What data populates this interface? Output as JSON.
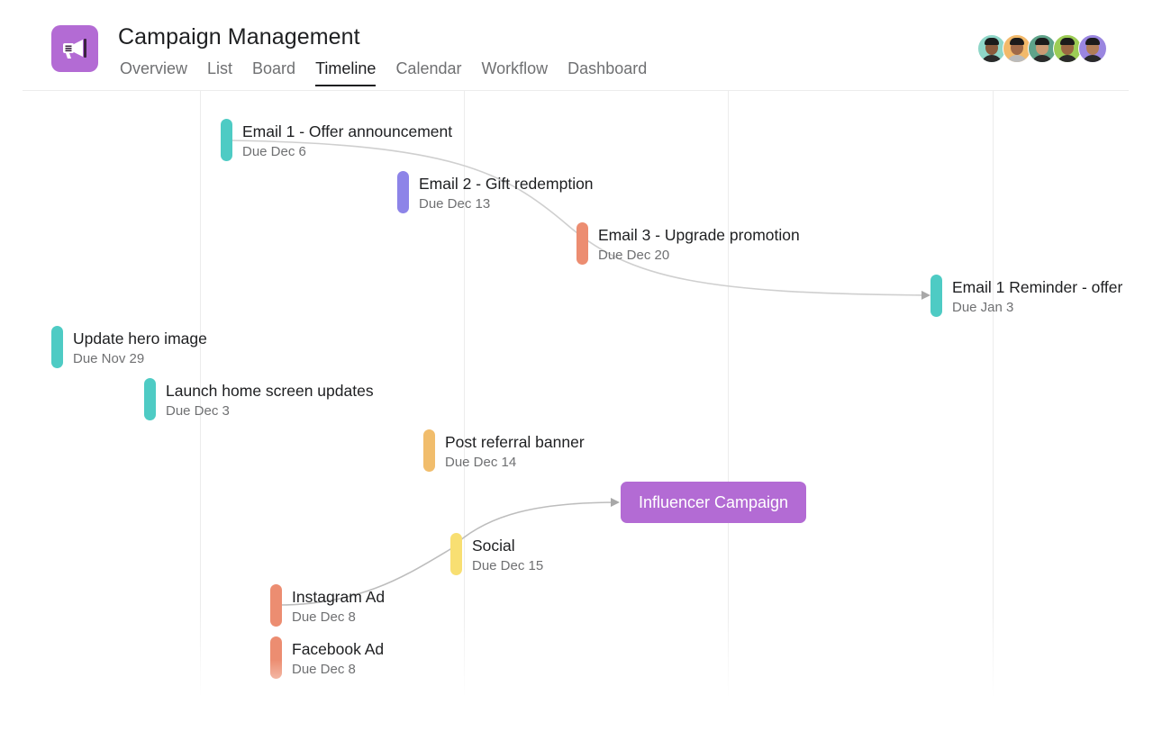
{
  "header": {
    "title": "Campaign Management",
    "app_icon": "megaphone-icon",
    "app_icon_color": "#b36bd4",
    "tabs": [
      {
        "label": "Overview",
        "active": false
      },
      {
        "label": "List",
        "active": false
      },
      {
        "label": "Board",
        "active": false
      },
      {
        "label": "Timeline",
        "active": true
      },
      {
        "label": "Calendar",
        "active": false
      },
      {
        "label": "Workflow",
        "active": false
      },
      {
        "label": "Dashboard",
        "active": false
      }
    ],
    "avatars": [
      {
        "color": "#8fd6c8"
      },
      {
        "color": "#f2b96a"
      },
      {
        "color": "#5fa38a"
      },
      {
        "color": "#9ccc55"
      },
      {
        "color": "#9a86e0"
      }
    ]
  },
  "timeline": {
    "tasks": [
      {
        "name": "Email 1 - Offer announcement",
        "due": "Due Dec 6",
        "color": "#4ecbc4"
      },
      {
        "name": "Email 2 - Gift redemption",
        "due": "Due Dec 13",
        "color": "#8d84e8"
      },
      {
        "name": "Email 3 - Upgrade promotion",
        "due": "Due Dec 20",
        "color": "#ec8d71"
      },
      {
        "name": "Email 1 Reminder - offer",
        "due": "Due Jan 3",
        "color": "#4ecbc4"
      },
      {
        "name": "Update hero image",
        "due": "Due Nov 29",
        "color": "#4ecbc4"
      },
      {
        "name": "Launch home screen updates",
        "due": "Due Dec 3",
        "color": "#4ecbc4"
      },
      {
        "name": "Post referral banner",
        "due": "Due Dec 14",
        "color": "#f1bd6c"
      },
      {
        "name": "Social",
        "due": "Due Dec 15",
        "color": "#f8df72"
      },
      {
        "name": "Instagram Ad",
        "due": "Due Dec 8",
        "color": "#ec8d71"
      },
      {
        "name": "Facebook Ad",
        "due": "Due Dec 8",
        "color": "#ec8d71"
      }
    ],
    "milestone": {
      "label": "Influencer Campaign",
      "color": "#b36bd4"
    },
    "dependencies": [
      {
        "from": "Email 1 - Offer announcement",
        "to": "Email 1 Reminder - offer"
      },
      {
        "from": "Instagram Ad",
        "to": "Influencer Campaign"
      }
    ]
  }
}
